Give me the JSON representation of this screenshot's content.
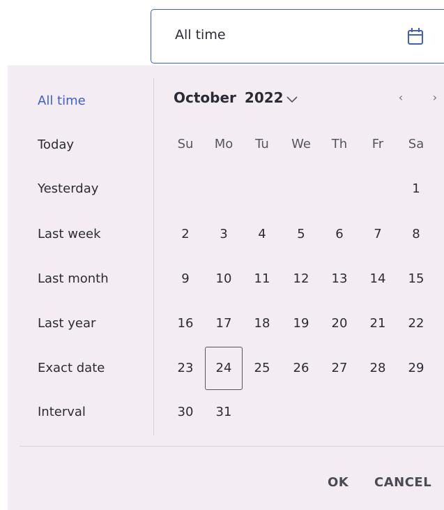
{
  "input": {
    "value": "All time",
    "icon": "calendar-icon"
  },
  "presets": [
    "All time",
    "Today",
    "Yesterday",
    "Last week",
    "Last month",
    "Last year",
    "Exact date",
    "Interval"
  ],
  "active_preset": "All time",
  "calendar": {
    "month": "October",
    "year": "2022",
    "prev_label": "‹",
    "next_label": "›",
    "weekdays": [
      "Su",
      "Mo",
      "Tu",
      "We",
      "Th",
      "Fr",
      "Sa"
    ],
    "first_weekday_index": 6,
    "days_in_month": 31,
    "highlighted_day": "24"
  },
  "actions": {
    "ok": "OK",
    "cancel": "CANCEL"
  },
  "colors": {
    "accent": "#3d5ecc",
    "panel_bg": "#f3ecf3",
    "text": "#2b2b35"
  }
}
